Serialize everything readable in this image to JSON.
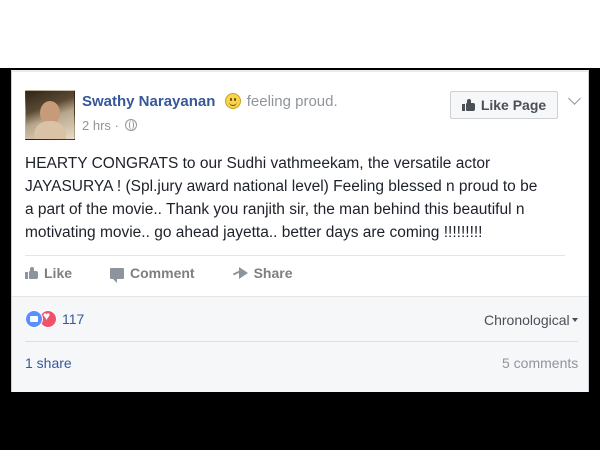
{
  "post": {
    "author": "Swathy Narayanan",
    "feeling": "feeling proud.",
    "time": "2 hrs",
    "time_separator": "·",
    "like_page_label": "Like Page",
    "text_lines": [
      "HEARTY CONGRATS to our Sudhi vathmeekam, the versatile actor",
      "JAYASURYA ! (Spl.jury award national level) Feeling blessed n proud to be",
      "a part of the movie.. Thank you ranjith sir, the man behind this beautiful n",
      "motivating movie.. go ahead jayetta.. better days are coming !!!!!!!!!"
    ]
  },
  "actions": {
    "like_label": "Like",
    "comment_label": "Comment",
    "share_label": "Share"
  },
  "summary": {
    "reaction_count": "117",
    "sort_label": "Chronological",
    "shares": "1 share",
    "comments": "5 comments"
  },
  "colors": {
    "link_blue": "#365899",
    "like_blue": "#5890ff",
    "love_red": "#f25268"
  },
  "icons": {
    "avatar": "user-photo",
    "feeling": "smiley-face-icon",
    "privacy": "globe-icon",
    "like_page": "thumbs-up-icon",
    "menu": "chevron-down-icon",
    "reaction_like": "like-reaction-icon",
    "reaction_love": "love-reaction-icon"
  }
}
